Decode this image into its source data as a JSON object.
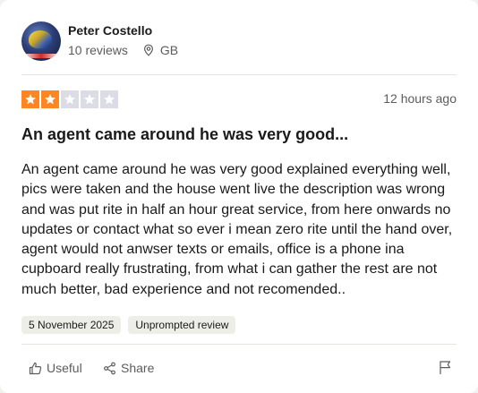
{
  "reviewer": {
    "name": "Peter Costello",
    "reviews_count": "10 reviews",
    "location": "GB"
  },
  "review": {
    "rating": 2,
    "max_rating": 5,
    "time_ago": "12 hours ago",
    "title": "An agent came around he was very good...",
    "body": "An agent came around he was very good explained everything well, pics were taken and the house went live the description was wrong and was put rite in half an hour great service, from here onwards no updates or contact what so ever i mean zero rite until the hand over, agent would not anwser texts or emails, office is a phone ina cupboard really frustrating, from what i can gather the rest are not much better, bad experience and not recomended..",
    "date_tag": "5 November 2025",
    "source_tag": "Unprompted review"
  },
  "actions": {
    "useful_label": "Useful",
    "share_label": "Share"
  },
  "colors": {
    "star_on": "#ff8622",
    "star_off": "#dcdce6"
  },
  "icons": [
    "location-pin-icon",
    "star-icon",
    "thumbs-up-icon",
    "share-icon",
    "flag-icon"
  ]
}
